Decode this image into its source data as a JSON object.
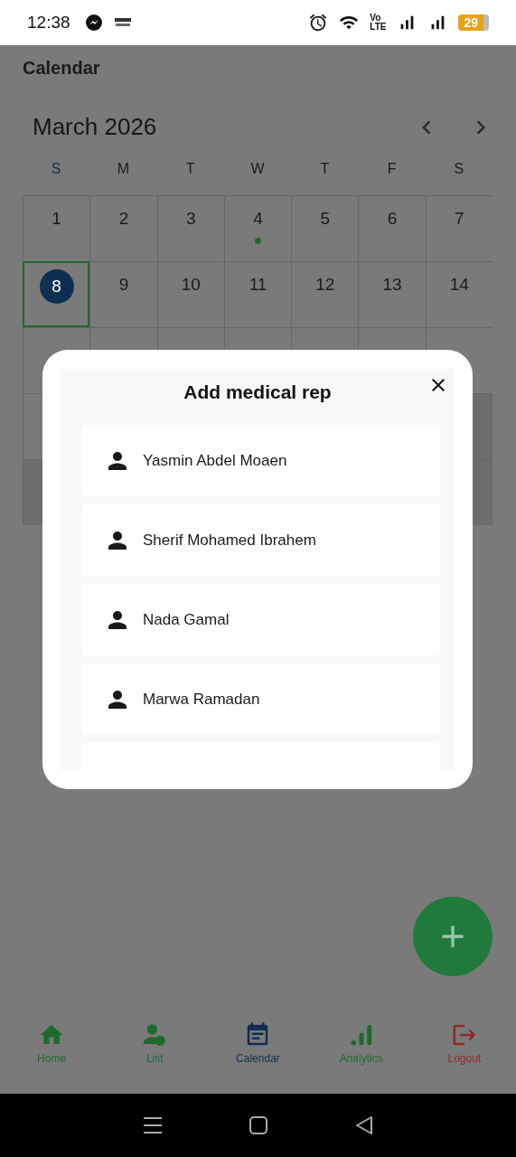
{
  "status_bar": {
    "time": "12:38",
    "volte_top": "Vo",
    "volte_bottom": "LTE",
    "battery": "29"
  },
  "page_title": "Calendar",
  "calendar": {
    "month": "March 2026",
    "weekdays": [
      "S",
      "M",
      "T",
      "W",
      "T",
      "F",
      "S"
    ],
    "weeks": [
      {
        "kind": "days",
        "days": [
          {
            "label": "1",
            "selected": false,
            "has_event": false
          },
          {
            "label": "2",
            "selected": false,
            "has_event": false
          },
          {
            "label": "3",
            "selected": false,
            "has_event": false
          },
          {
            "label": "4",
            "selected": false,
            "has_event": true
          },
          {
            "label": "5",
            "selected": false,
            "has_event": false
          },
          {
            "label": "6",
            "selected": false,
            "has_event": false
          },
          {
            "label": "7",
            "selected": false,
            "has_event": false
          }
        ]
      },
      {
        "kind": "days",
        "days": [
          {
            "label": "8",
            "selected": true,
            "has_event": false
          },
          {
            "label": "9",
            "selected": false,
            "has_event": false
          },
          {
            "label": "10",
            "selected": false,
            "has_event": false
          },
          {
            "label": "11",
            "selected": false,
            "has_event": false
          },
          {
            "label": "12",
            "selected": false,
            "has_event": false
          },
          {
            "label": "13",
            "selected": false,
            "has_event": false
          },
          {
            "label": "14",
            "selected": false,
            "has_event": false
          }
        ]
      },
      {
        "kind": "covered"
      },
      {
        "kind": "covered_edge"
      },
      {
        "kind": "covered_shaded"
      }
    ]
  },
  "dialog": {
    "title": "Add medical rep",
    "reps": [
      "Yasmin Abdel Moaen",
      "Sherif Mohamed Ibrahem",
      "Nada Gamal",
      "Marwa Ramadan"
    ]
  },
  "nav": [
    {
      "label": "Home",
      "kind": "home",
      "color": "#1d6a2d"
    },
    {
      "label": "List",
      "kind": "list",
      "color": "#1d6a2d"
    },
    {
      "label": "Calendar",
      "kind": "calendar",
      "color": "#0e2f52"
    },
    {
      "label": "Analytics",
      "kind": "analytics",
      "color": "#1d6a2d"
    },
    {
      "label": "Logout",
      "kind": "logout",
      "color": "#8e2a26"
    }
  ]
}
